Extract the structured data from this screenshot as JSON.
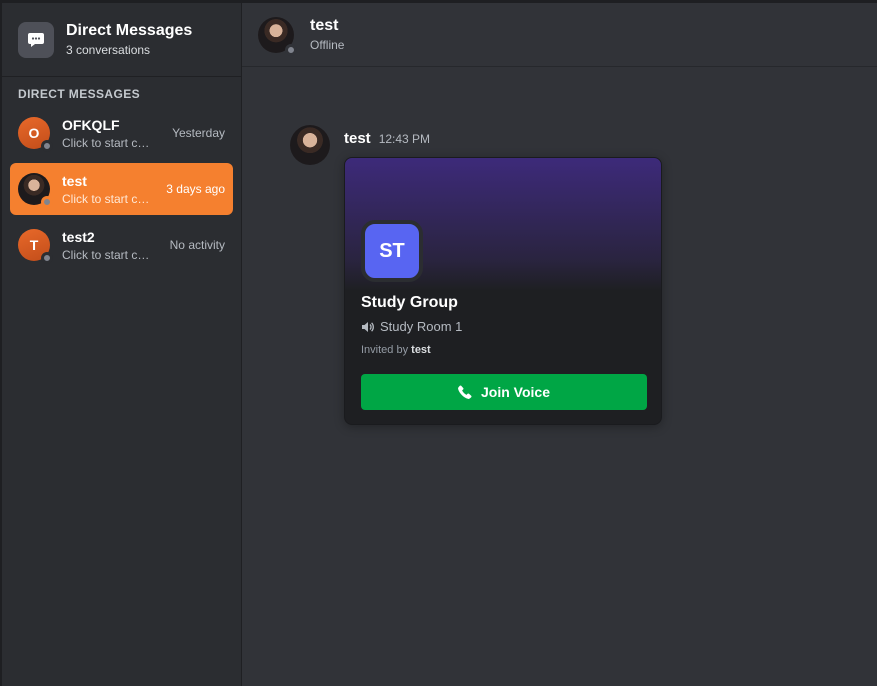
{
  "sidebar": {
    "title": "Direct Messages",
    "subtitle": "3 conversations",
    "section_label": "DIRECT MESSAGES",
    "items": [
      {
        "initial": "O",
        "name": "OFKQLF",
        "preview": "Click to start conversation",
        "time": "Yesterday",
        "avatar": "letter",
        "active": false
      },
      {
        "initial": "",
        "name": "test",
        "preview": "Click to start conversation",
        "time": "3 days ago",
        "avatar": "photo",
        "active": true
      },
      {
        "initial": "T",
        "name": "test2",
        "preview": "Click to start conversation",
        "time": "No activity",
        "avatar": "letter",
        "active": false
      }
    ]
  },
  "header": {
    "name": "test",
    "status": "Offline"
  },
  "message": {
    "author": "test",
    "time": "12:43 PM",
    "invite": {
      "server_initials": "ST",
      "server_name": "Study Group",
      "channel_name": "Study Room 1",
      "invited_by_prefix": "Invited by",
      "invited_by_user": "test",
      "button_label": "Join Voice"
    }
  },
  "colors": {
    "accent": "#f5802f",
    "join_button": "#00a645",
    "server_icon": "#5865f2",
    "sidebar_bg": "#2b2d31",
    "main_bg": "#313338"
  },
  "icons": {
    "header": "chat-bubble-icon",
    "channel": "speaker-icon",
    "button": "phone-icon",
    "status": "offline-dot"
  }
}
